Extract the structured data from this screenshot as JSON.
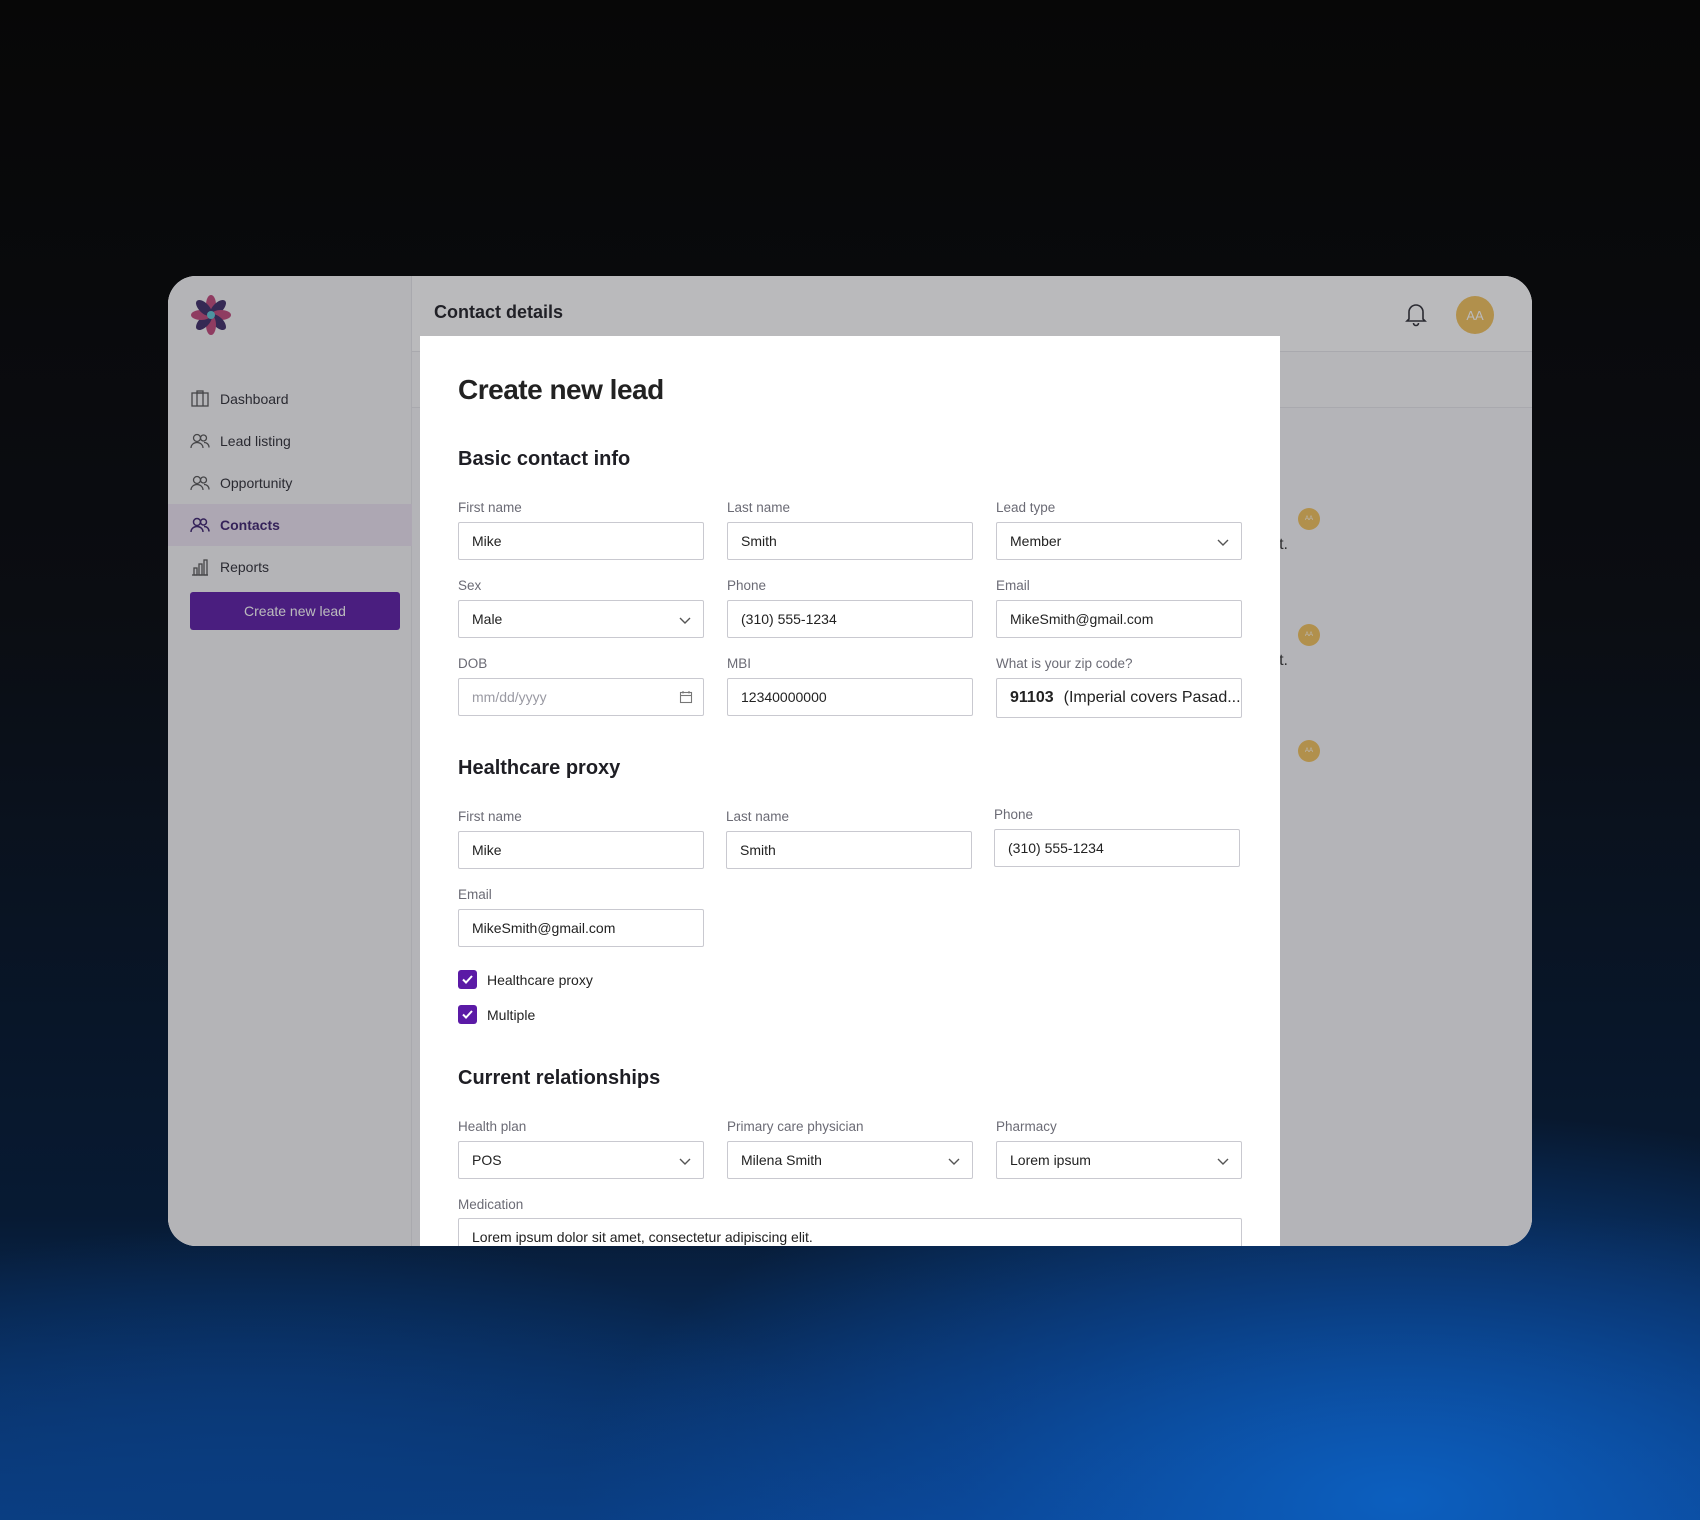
{
  "sidebar": {
    "items": [
      {
        "label": "Dashboard",
        "icon": "dashboard-icon"
      },
      {
        "label": "Lead listing",
        "icon": "users-icon"
      },
      {
        "label": "Opportunity",
        "icon": "users-icon"
      },
      {
        "label": "Contacts",
        "icon": "users-icon",
        "active": true
      },
      {
        "label": "Reports",
        "icon": "bar-chart-icon"
      }
    ],
    "create_button": "Create new lead"
  },
  "header": {
    "title": "Contact details",
    "avatar_initials": "AA"
  },
  "background": {
    "row_text": "lit.",
    "dot_initials": "AA"
  },
  "modal": {
    "title": "Create new lead",
    "basic": {
      "title": "Basic contact info",
      "first_name_label": "First name",
      "first_name": "Mike",
      "last_name_label": "Last name",
      "last_name": "Smith",
      "lead_type_label": "Lead type",
      "lead_type": "Member",
      "sex_label": "Sex",
      "sex": "Male",
      "phone_label": "Phone",
      "phone": "(310) 555-1234",
      "email_label": "Email",
      "email": "MikeSmith@gmail.com",
      "dob_label": "DOB",
      "dob_placeholder": "mm/dd/yyyy",
      "mbi_label": "MBI",
      "mbi": "12340000000",
      "zip_label": "What is your zip code?",
      "zip_code": "91103",
      "zip_area": "(Imperial covers Pasad..."
    },
    "proxy": {
      "title": "Healthcare proxy",
      "first_name_label": "First name",
      "first_name": "Mike",
      "last_name_label": "Last name",
      "last_name": "Smith",
      "phone_label": "Phone",
      "phone": "(310) 555-1234",
      "email_label": "Email",
      "email": "MikeSmith@gmail.com",
      "checkbox_proxy": "Healthcare proxy",
      "checkbox_multiple": "Multiple"
    },
    "relationships": {
      "title": "Current relationships",
      "health_plan_label": "Health plan",
      "health_plan": "POS",
      "pcp_label": "Primary care  physician",
      "pcp": "Milena Smith",
      "pharmacy_label": "Pharmacy",
      "pharmacy": "Lorem ipsum",
      "medication_label": "Medication",
      "medication": "Lorem ipsum dolor sit amet, consectetur adipiscing elit."
    }
  },
  "colors": {
    "accent": "#5b1aa6",
    "avatar": "#f2c15a"
  }
}
